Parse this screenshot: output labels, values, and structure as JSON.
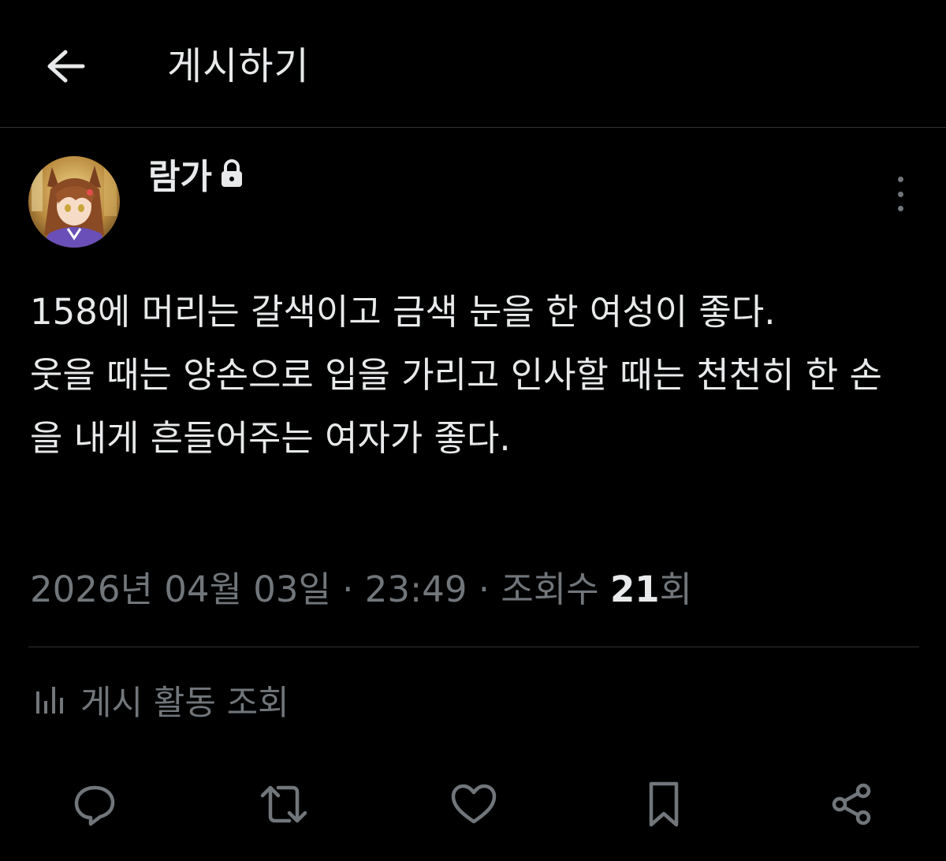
{
  "header": {
    "title": "게시하기",
    "back_icon": "arrow-left-icon"
  },
  "post": {
    "author_name": "람가",
    "author_protected_icon": "lock-icon",
    "more_icon": "more-vertical-icon",
    "text": "158에 머리는 갈색이고 금색 눈을 한 여성이 좋다.\n웃을 때는 양손으로 입을 가리고 인사할 때는 천천히 한 손을 내게 흔들어주는 여자가 좋다.",
    "date": "2026년 04월 03일",
    "separator": "·",
    "time": "23:49",
    "views_prefix": "조회수",
    "views_count": "21",
    "views_suffix": "회"
  },
  "activity": {
    "icon": "analytics-icon",
    "label": "게시 활동 조회"
  },
  "actions": [
    {
      "name": "reply",
      "icon": "reply-icon"
    },
    {
      "name": "retweet",
      "icon": "retweet-icon"
    },
    {
      "name": "like",
      "icon": "heart-icon"
    },
    {
      "name": "bookmark",
      "icon": "bookmark-icon"
    },
    {
      "name": "share",
      "icon": "share-icon"
    }
  ],
  "colors": {
    "background": "#000000",
    "text_primary": "#e7e9ea",
    "text_secondary": "#71767b",
    "divider": "#2f3336"
  }
}
